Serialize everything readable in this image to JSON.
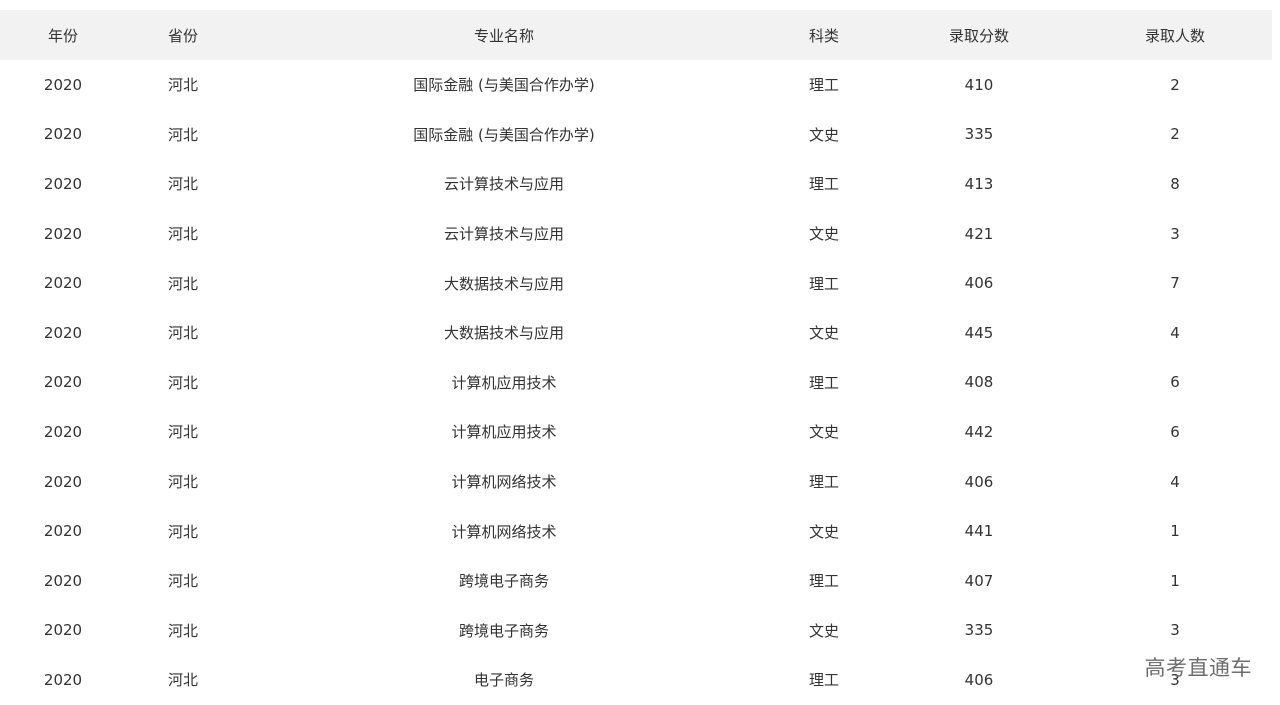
{
  "table": {
    "headers": [
      "年份",
      "省份",
      "专业名称",
      "科类",
      "录取分数",
      "录取人数"
    ],
    "rows": [
      [
        "2020",
        "河北",
        "国际金融 (与美国合作办学)",
        "理工",
        "410",
        "2"
      ],
      [
        "2020",
        "河北",
        "国际金融 (与美国合作办学)",
        "文史",
        "335",
        "2"
      ],
      [
        "2020",
        "河北",
        "云计算技术与应用",
        "理工",
        "413",
        "8"
      ],
      [
        "2020",
        "河北",
        "云计算技术与应用",
        "文史",
        "421",
        "3"
      ],
      [
        "2020",
        "河北",
        "大数据技术与应用",
        "理工",
        "406",
        "7"
      ],
      [
        "2020",
        "河北",
        "大数据技术与应用",
        "文史",
        "445",
        "4"
      ],
      [
        "2020",
        "河北",
        "计算机应用技术",
        "理工",
        "408",
        "6"
      ],
      [
        "2020",
        "河北",
        "计算机应用技术",
        "文史",
        "442",
        "6"
      ],
      [
        "2020",
        "河北",
        "计算机网络技术",
        "理工",
        "406",
        "4"
      ],
      [
        "2020",
        "河北",
        "计算机网络技术",
        "文史",
        "441",
        "1"
      ],
      [
        "2020",
        "河北",
        "跨境电子商务",
        "理工",
        "407",
        "1"
      ],
      [
        "2020",
        "河北",
        "跨境电子商务",
        "文史",
        "335",
        "3"
      ],
      [
        "2020",
        "河北",
        "电子商务",
        "理工",
        "406",
        "3"
      ]
    ]
  },
  "watermark": {
    "text": "高考直通车"
  },
  "colors": {
    "header_bg": "#f2f2f2",
    "text": "#333333",
    "watermark": "#6e6e6e"
  }
}
